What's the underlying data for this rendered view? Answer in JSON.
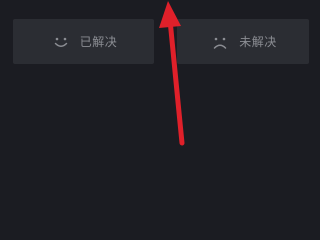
{
  "feedback": {
    "resolved": {
      "label": "已解决",
      "icon": "smile-face-icon"
    },
    "unresolved": {
      "label": "未解决",
      "icon": "frown-face-icon"
    }
  },
  "colors": {
    "background": "#1b1c22",
    "button_background": "#2b2d33",
    "label_text": "#8b8d93",
    "arrow": "#e0202a"
  }
}
